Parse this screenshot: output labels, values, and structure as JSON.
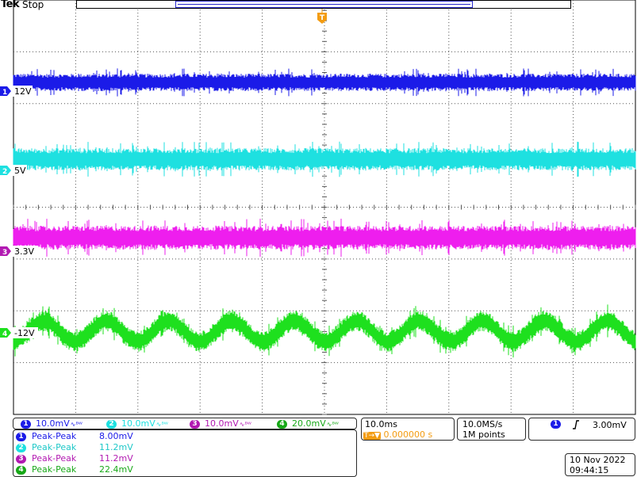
{
  "header": {
    "brand": "Tek",
    "status": "Stop"
  },
  "trigger_marker": "T",
  "channels": [
    {
      "id": "1",
      "label": "12V",
      "color": "#1b1be8",
      "scale": "10.0mV",
      "meas_name": "Peak-Peak",
      "meas_value": "8.00mV"
    },
    {
      "id": "2",
      "label": "5V",
      "color": "#1ee0e0",
      "scale": "10.0mV",
      "meas_name": "Peak-Peak",
      "meas_value": "11.2mV"
    },
    {
      "id": "3",
      "label": "3.3V",
      "color": "#ee1eee",
      "scale": "10.0mV",
      "meas_name": "Peak-Peak",
      "meas_value": "11.2mV"
    },
    {
      "id": "4",
      "label": "-12V",
      "color": "#1ee01e",
      "scale": "20.0mV",
      "meas_name": "Peak-Peak",
      "meas_value": "22.4mV"
    }
  ],
  "bandwidth_symbol": "∿ᴮᵂ",
  "timebase": {
    "scale": "10.0ms",
    "delay": "0.000000 s",
    "delay_marker": "T→▼"
  },
  "acquisition": {
    "rate": "10.0MS/s",
    "length": "1M points"
  },
  "trigger": {
    "source": "1",
    "slope_icon": "rising-edge",
    "level": "3.00mV"
  },
  "datetime": {
    "date": "10 Nov 2022",
    "time": "09:44:15"
  }
}
